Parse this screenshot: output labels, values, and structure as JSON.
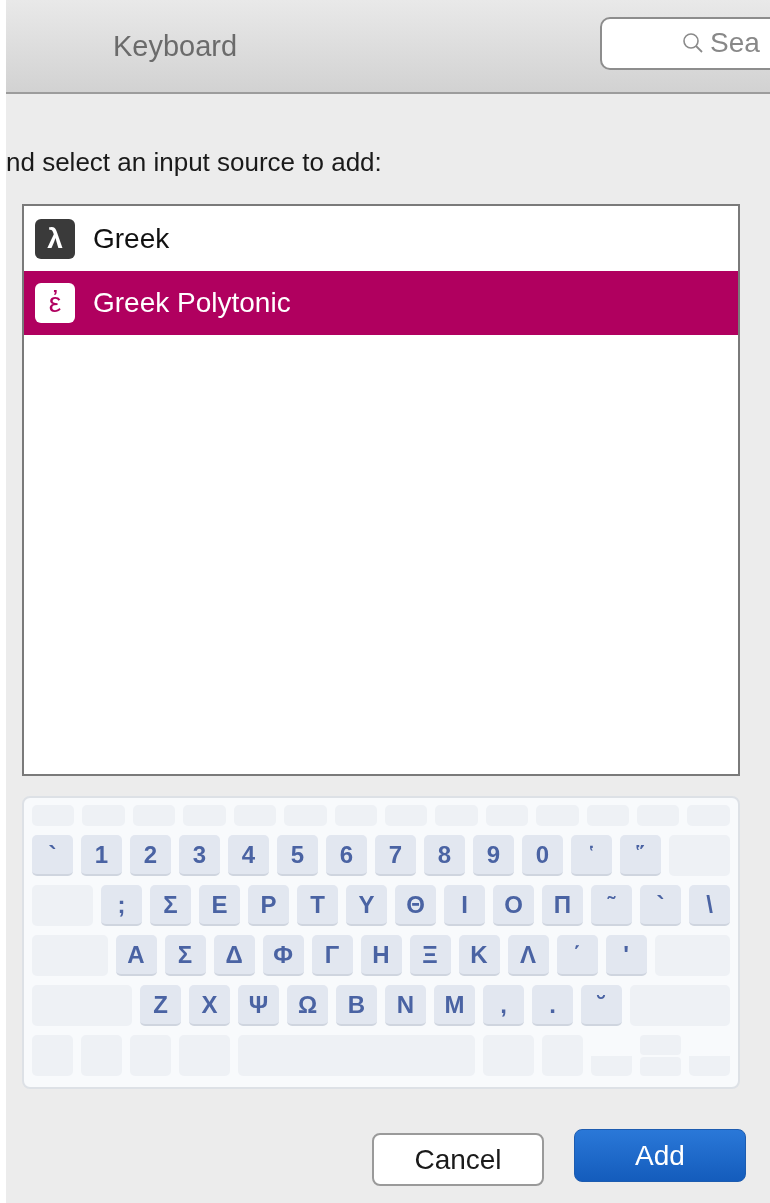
{
  "toolbar": {
    "title": "Keyboard",
    "search": {
      "placeholder": "Sea"
    }
  },
  "prompt": "nd select an input source to add:",
  "sources": [
    {
      "name": "Greek",
      "icon": "λ",
      "selected": false
    },
    {
      "name": "Greek Polytonic",
      "icon": "ἐ",
      "selected": true
    }
  ],
  "keyboard": {
    "rows": [
      [
        {
          "kind": "fn"
        },
        {
          "kind": "fn"
        },
        {
          "kind": "fn"
        },
        {
          "kind": "fn"
        },
        {
          "kind": "fn"
        },
        {
          "kind": "fn"
        },
        {
          "kind": "fn"
        },
        {
          "kind": "fn"
        },
        {
          "kind": "fn"
        },
        {
          "kind": "fn"
        },
        {
          "kind": "fn"
        },
        {
          "kind": "fn"
        },
        {
          "kind": "fn"
        },
        {
          "kind": "fn"
        }
      ],
      [
        {
          "kind": "key",
          "label": "`"
        },
        {
          "kind": "key",
          "label": "1"
        },
        {
          "kind": "key",
          "label": "2"
        },
        {
          "kind": "key",
          "label": "3"
        },
        {
          "kind": "key",
          "label": "4"
        },
        {
          "kind": "key",
          "label": "5"
        },
        {
          "kind": "key",
          "label": "6"
        },
        {
          "kind": "key",
          "label": "7"
        },
        {
          "kind": "key",
          "label": "8"
        },
        {
          "kind": "key",
          "label": "9"
        },
        {
          "kind": "key",
          "label": "0"
        },
        {
          "kind": "key",
          "label": "῾"
        },
        {
          "kind": "key",
          "label": "῞"
        },
        {
          "kind": "blank"
        }
      ],
      [
        {
          "kind": "blank"
        },
        {
          "kind": "key",
          "label": ";"
        },
        {
          "kind": "key",
          "label": "Σ"
        },
        {
          "kind": "key",
          "label": "Ε"
        },
        {
          "kind": "key",
          "label": "Ρ"
        },
        {
          "kind": "key",
          "label": "Τ"
        },
        {
          "kind": "key",
          "label": "Υ"
        },
        {
          "kind": "key",
          "label": "Θ"
        },
        {
          "kind": "key",
          "label": "Ι"
        },
        {
          "kind": "key",
          "label": "Ο"
        },
        {
          "kind": "key",
          "label": "Π"
        },
        {
          "kind": "key",
          "label": "῀"
        },
        {
          "kind": "key",
          "label": "`"
        },
        {
          "kind": "key",
          "label": "\\"
        }
      ],
      [
        {
          "kind": "blank"
        },
        {
          "kind": "key",
          "label": "Α"
        },
        {
          "kind": "key",
          "label": "Σ"
        },
        {
          "kind": "key",
          "label": "Δ"
        },
        {
          "kind": "key",
          "label": "Φ"
        },
        {
          "kind": "key",
          "label": "Γ"
        },
        {
          "kind": "key",
          "label": "Η"
        },
        {
          "kind": "key",
          "label": "Ξ"
        },
        {
          "kind": "key",
          "label": "Κ"
        },
        {
          "kind": "key",
          "label": "Λ"
        },
        {
          "kind": "key",
          "label": "΄"
        },
        {
          "kind": "key",
          "label": "'"
        },
        {
          "kind": "blank"
        }
      ],
      [
        {
          "kind": "blank"
        },
        {
          "kind": "key",
          "label": "Ζ"
        },
        {
          "kind": "key",
          "label": "Χ"
        },
        {
          "kind": "key",
          "label": "Ψ"
        },
        {
          "kind": "key",
          "label": "Ω"
        },
        {
          "kind": "key",
          "label": "Β"
        },
        {
          "kind": "key",
          "label": "Ν"
        },
        {
          "kind": "key",
          "label": "Μ"
        },
        {
          "kind": "key",
          "label": ","
        },
        {
          "kind": "key",
          "label": "."
        },
        {
          "kind": "key",
          "label": "˘"
        },
        {
          "kind": "blank"
        }
      ],
      [
        {
          "kind": "mod"
        },
        {
          "kind": "mod"
        },
        {
          "kind": "mod"
        },
        {
          "kind": "cmd"
        },
        {
          "kind": "space"
        },
        {
          "kind": "cmd"
        },
        {
          "kind": "mod"
        },
        {
          "kind": "arrow"
        },
        {
          "kind": "arrows"
        },
        {
          "kind": "arrow"
        }
      ]
    ]
  },
  "buttons": [
    {
      "label": "Cancel",
      "default": false
    },
    {
      "label": "Add",
      "default": true
    }
  ]
}
